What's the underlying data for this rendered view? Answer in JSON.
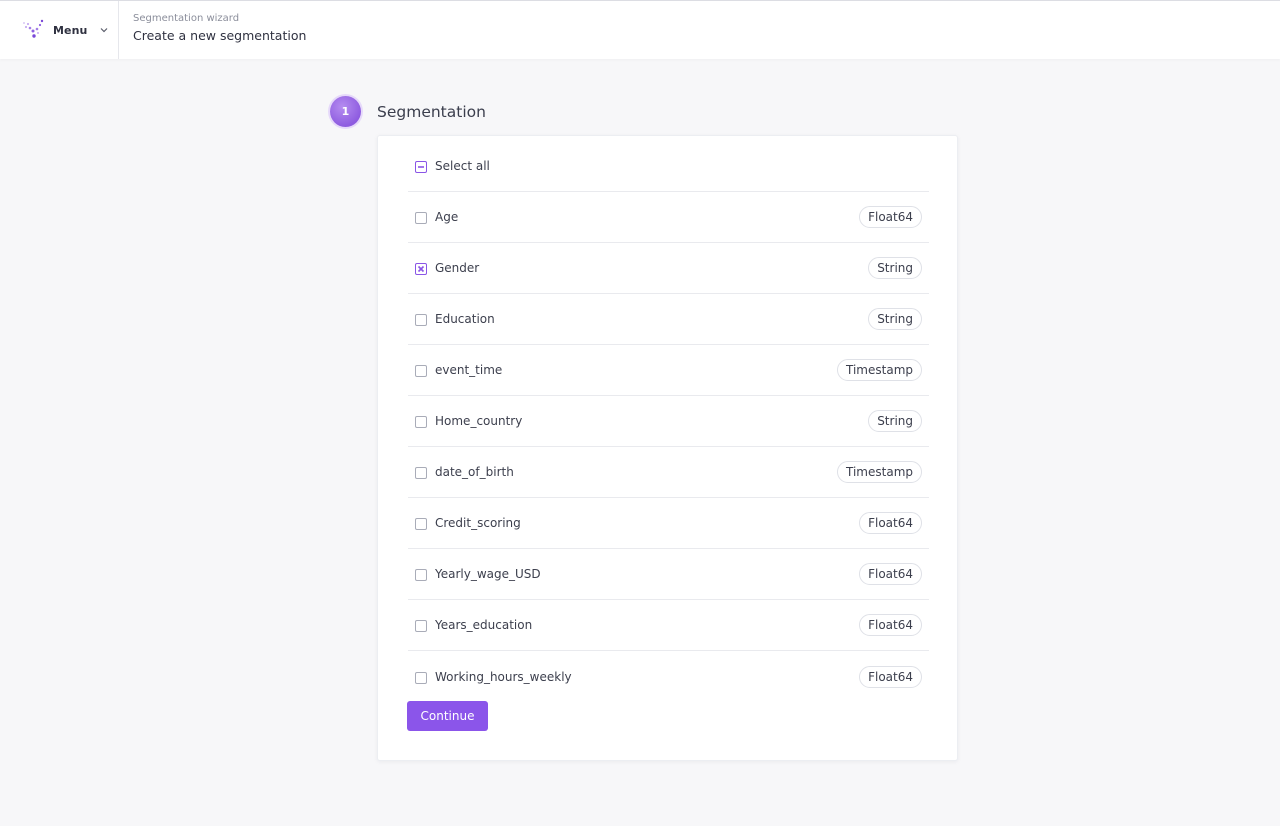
{
  "header": {
    "menu_label": "Menu",
    "breadcrumb": "Segmentation wizard",
    "title": "Create a new segmentation"
  },
  "step": {
    "number": "1",
    "title": "Segmentation"
  },
  "select_all": {
    "label": "Select all",
    "state": "indeterminate"
  },
  "fields": [
    {
      "label": "Age",
      "type": "Float64",
      "checked": false
    },
    {
      "label": "Gender",
      "type": "String",
      "checked": true
    },
    {
      "label": "Education",
      "type": "String",
      "checked": false
    },
    {
      "label": "event_time",
      "type": "Timestamp",
      "checked": false
    },
    {
      "label": "Home_country",
      "type": "String",
      "checked": false
    },
    {
      "label": "date_of_birth",
      "type": "Timestamp",
      "checked": false
    },
    {
      "label": "Credit_scoring",
      "type": "Float64",
      "checked": false
    },
    {
      "label": "Yearly_wage_USD",
      "type": "Float64",
      "checked": false
    },
    {
      "label": "Years_education",
      "type": "Float64",
      "checked": false
    },
    {
      "label": "Working_hours_weekly",
      "type": "Float64",
      "checked": false
    }
  ],
  "continue_label": "Continue",
  "colors": {
    "accent": "#8b55ea",
    "background": "#f7f7f9"
  },
  "icons": {
    "logo": "dots-logo-icon",
    "menu_chevron": "chevron-down-icon",
    "select_all": "minus-square-icon",
    "checked": "x-square-icon"
  }
}
